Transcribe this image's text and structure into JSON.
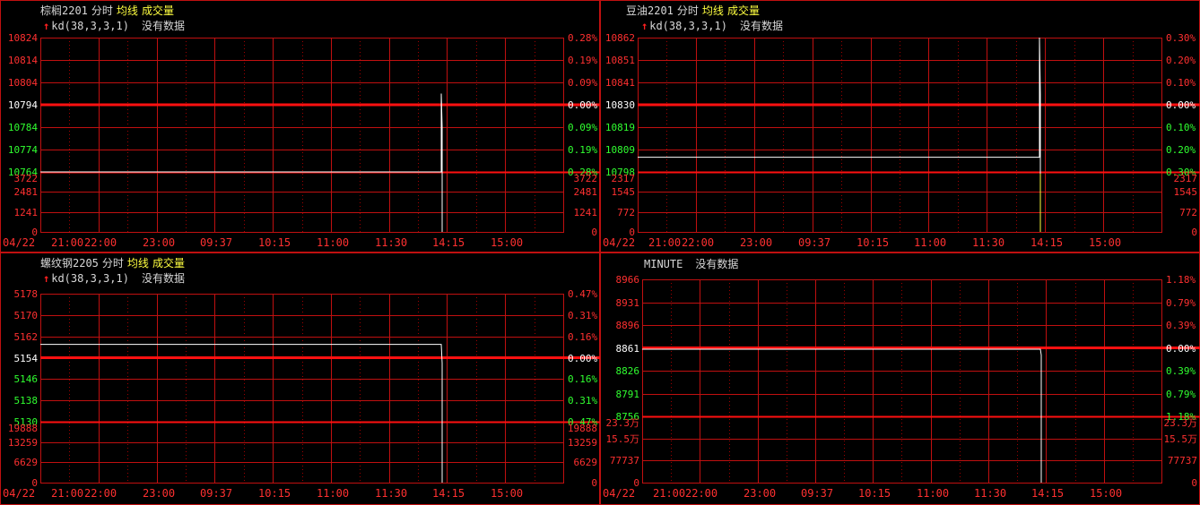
{
  "colors": {
    "grid": "#c01010",
    "grid_dot": "#a00000",
    "base": "#ff1010",
    "price": "#ffffff",
    "up": "#ff3030",
    "down": "#30ff30",
    "avg": "#ffff40"
  },
  "time_axis": [
    "04/22",
    "21:00",
    "22:00",
    "23:00",
    "09:37",
    "10:15",
    "11:00",
    "11:30",
    "14:15",
    "15:00"
  ],
  "panels": [
    {
      "id": "p1",
      "symbol": "棕榈2201",
      "mode": "分时",
      "avg_label": "均线",
      "volume_label": "成交量",
      "indicator": "kd(38,3,3,1)",
      "status": "没有数据",
      "price_labels": [
        {
          "t": "10824",
          "c": "r"
        },
        {
          "t": "10814",
          "c": "r"
        },
        {
          "t": "10804",
          "c": "r"
        },
        {
          "t": "10794",
          "c": "w"
        },
        {
          "t": "10784",
          "c": "g"
        },
        {
          "t": "10774",
          "c": "g"
        },
        {
          "t": "10764",
          "c": "g"
        }
      ],
      "pct_labels": [
        {
          "t": "0.28%",
          "c": "r"
        },
        {
          "t": "0.19%",
          "c": "r"
        },
        {
          "t": "0.09%",
          "c": "r"
        },
        {
          "t": "0.00%",
          "c": "w"
        },
        {
          "t": "0.09%",
          "c": "g"
        },
        {
          "t": "0.19%",
          "c": "g"
        },
        {
          "t": "0.28%",
          "c": "g"
        }
      ],
      "vol_labels_left": [
        "3722",
        "2481",
        "1241",
        "0"
      ],
      "vol_labels_right": [
        "3722",
        "2481",
        "1241",
        "0"
      ],
      "chart_data": {
        "type": "line",
        "ylim": [
          10764,
          10824
        ],
        "base": 10794,
        "price_level": 10764,
        "spike_top": 10799,
        "spike_mid": 10784
      }
    },
    {
      "id": "p2",
      "symbol": "豆油2201",
      "mode": "分时",
      "avg_label": "均线",
      "volume_label": "成交量",
      "indicator": "kd(38,3,3,1)",
      "status": "没有数据",
      "price_labels": [
        {
          "t": "10862",
          "c": "r"
        },
        {
          "t": "10851",
          "c": "r"
        },
        {
          "t": "10841",
          "c": "r"
        },
        {
          "t": "10830",
          "c": "w"
        },
        {
          "t": "10819",
          "c": "g"
        },
        {
          "t": "10809",
          "c": "g"
        },
        {
          "t": "10798",
          "c": "g"
        }
      ],
      "pct_labels": [
        {
          "t": "0.30%",
          "c": "r"
        },
        {
          "t": "0.20%",
          "c": "r"
        },
        {
          "t": "0.10%",
          "c": "r"
        },
        {
          "t": "0.00%",
          "c": "w"
        },
        {
          "t": "0.10%",
          "c": "g"
        },
        {
          "t": "0.20%",
          "c": "g"
        },
        {
          "t": "0.30%",
          "c": "g"
        }
      ],
      "vol_labels_left": [
        "2317",
        "1545",
        "772",
        "0"
      ],
      "vol_labels_right": [
        "2317",
        "1545",
        "772",
        "0"
      ],
      "chart_data": {
        "type": "line",
        "ylim": [
          10798,
          10862
        ],
        "base": 10830,
        "price_level": 10805,
        "spike_top": 10862,
        "spike_mid": 10835
      }
    },
    {
      "id": "p3",
      "symbol": "螺纹钢2205",
      "mode": "分时",
      "avg_label": "均线",
      "volume_label": "成交量",
      "indicator": "kd(38,3,3,1)",
      "status": "没有数据",
      "price_labels": [
        {
          "t": "5178",
          "c": "r"
        },
        {
          "t": "5170",
          "c": "r"
        },
        {
          "t": "5162",
          "c": "r"
        },
        {
          "t": "5154",
          "c": "w"
        },
        {
          "t": "5146",
          "c": "g"
        },
        {
          "t": "5138",
          "c": "g"
        },
        {
          "t": "5130",
          "c": "g"
        }
      ],
      "pct_labels": [
        {
          "t": "0.47%",
          "c": "r"
        },
        {
          "t": "0.31%",
          "c": "r"
        },
        {
          "t": "0.16%",
          "c": "r"
        },
        {
          "t": "0.00%",
          "c": "w"
        },
        {
          "t": "0.16%",
          "c": "g"
        },
        {
          "t": "0.31%",
          "c": "g"
        },
        {
          "t": "0.47%",
          "c": "g"
        }
      ],
      "vol_labels_left": [
        "19888",
        "13259",
        "6629",
        "0"
      ],
      "vol_labels_right": [
        "19888",
        "13259",
        "6629",
        "0"
      ],
      "chart_data": {
        "type": "line",
        "ylim": [
          5130,
          5178
        ],
        "base": 5154,
        "price_level": 5159,
        "spike_top": 5159,
        "spike_mid": 5152
      }
    },
    {
      "id": "p4",
      "symbol": "MINUTE",
      "status": "没有数据",
      "price_labels": [
        {
          "t": "8966",
          "c": "r"
        },
        {
          "t": "8931",
          "c": "r"
        },
        {
          "t": "8896",
          "c": "r"
        },
        {
          "t": "8861",
          "c": "w"
        },
        {
          "t": "8826",
          "c": "g"
        },
        {
          "t": "8791",
          "c": "g"
        },
        {
          "t": "8756",
          "c": "g"
        }
      ],
      "pct_labels": [
        {
          "t": "1.18%",
          "c": "r"
        },
        {
          "t": "0.79%",
          "c": "r"
        },
        {
          "t": "0.39%",
          "c": "r"
        },
        {
          "t": "0.00%",
          "c": "w"
        },
        {
          "t": "0.39%",
          "c": "g"
        },
        {
          "t": "0.79%",
          "c": "g"
        },
        {
          "t": "1.18%",
          "c": "g"
        }
      ],
      "vol_labels_left": [
        "23.3万",
        "15.5万",
        "77737",
        "0"
      ],
      "vol_labels_right": [
        "23.3万",
        "15.5万",
        "77737",
        "0"
      ],
      "chart_data": {
        "type": "line",
        "ylim": [
          8756,
          8966
        ],
        "base": 8861,
        "price_level": 8859,
        "spike_top": 8859,
        "spike_mid": 8850
      }
    }
  ]
}
